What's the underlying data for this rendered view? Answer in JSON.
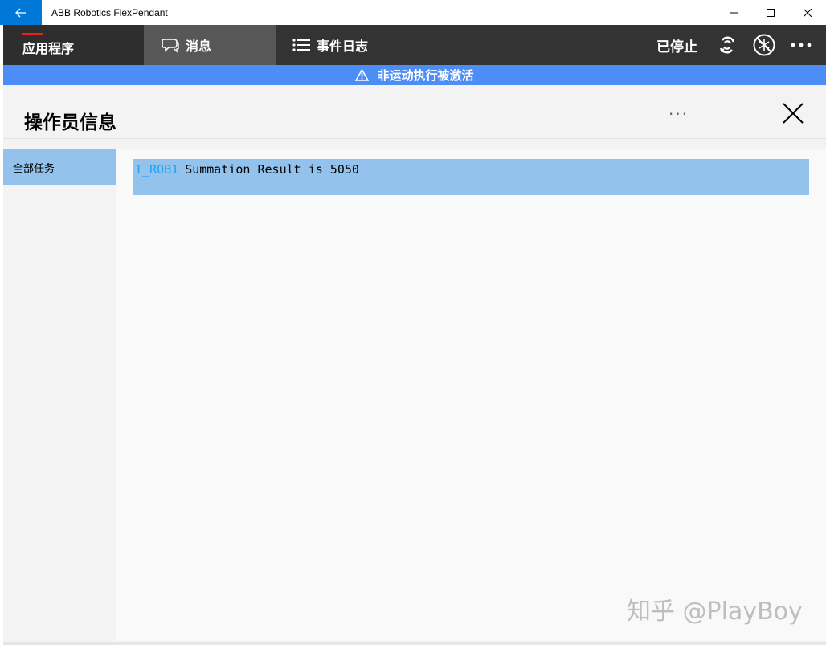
{
  "window": {
    "title": "ABB Robotics FlexPendant",
    "back_icon": "arrow-left-icon"
  },
  "navbar": {
    "tabs": [
      {
        "label": "应用程序",
        "active": false
      },
      {
        "label": "消息",
        "active": true
      },
      {
        "label": "事件日志",
        "active": false
      }
    ],
    "status": "已停止"
  },
  "banner": {
    "text": "非运动执行被激活"
  },
  "page": {
    "title": "操作员信息",
    "more": "···"
  },
  "sidebar": {
    "items": [
      {
        "label": "全部任务",
        "selected": true
      }
    ]
  },
  "messages": [
    {
      "task": "T_ROB1",
      "text": "Summation Result is 5050"
    }
  ],
  "watermark": "知乎 @PlayBoy",
  "colors": {
    "accent": "#0078d7",
    "banner": "#4d8df6",
    "selection": "#93c3ec",
    "task": "#1aa3f0",
    "indicator": "#e8221b"
  }
}
